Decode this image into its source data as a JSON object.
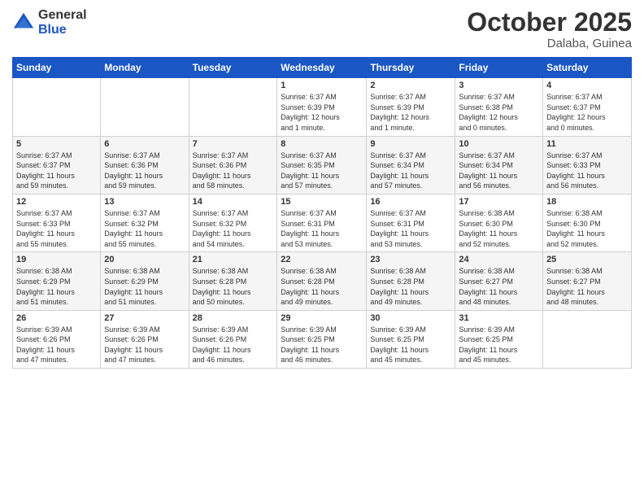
{
  "logo": {
    "general": "General",
    "blue": "Blue"
  },
  "title": "October 2025",
  "location": "Dalaba, Guinea",
  "days_header": [
    "Sunday",
    "Monday",
    "Tuesday",
    "Wednesday",
    "Thursday",
    "Friday",
    "Saturday"
  ],
  "weeks": [
    [
      {
        "num": "",
        "info": ""
      },
      {
        "num": "",
        "info": ""
      },
      {
        "num": "",
        "info": ""
      },
      {
        "num": "1",
        "info": "Sunrise: 6:37 AM\nSunset: 6:39 PM\nDaylight: 12 hours\nand 1 minute."
      },
      {
        "num": "2",
        "info": "Sunrise: 6:37 AM\nSunset: 6:39 PM\nDaylight: 12 hours\nand 1 minute."
      },
      {
        "num": "3",
        "info": "Sunrise: 6:37 AM\nSunset: 6:38 PM\nDaylight: 12 hours\nand 0 minutes."
      },
      {
        "num": "4",
        "info": "Sunrise: 6:37 AM\nSunset: 6:37 PM\nDaylight: 12 hours\nand 0 minutes."
      }
    ],
    [
      {
        "num": "5",
        "info": "Sunrise: 6:37 AM\nSunset: 6:37 PM\nDaylight: 11 hours\nand 59 minutes."
      },
      {
        "num": "6",
        "info": "Sunrise: 6:37 AM\nSunset: 6:36 PM\nDaylight: 11 hours\nand 59 minutes."
      },
      {
        "num": "7",
        "info": "Sunrise: 6:37 AM\nSunset: 6:36 PM\nDaylight: 11 hours\nand 58 minutes."
      },
      {
        "num": "8",
        "info": "Sunrise: 6:37 AM\nSunset: 6:35 PM\nDaylight: 11 hours\nand 57 minutes."
      },
      {
        "num": "9",
        "info": "Sunrise: 6:37 AM\nSunset: 6:34 PM\nDaylight: 11 hours\nand 57 minutes."
      },
      {
        "num": "10",
        "info": "Sunrise: 6:37 AM\nSunset: 6:34 PM\nDaylight: 11 hours\nand 56 minutes."
      },
      {
        "num": "11",
        "info": "Sunrise: 6:37 AM\nSunset: 6:33 PM\nDaylight: 11 hours\nand 56 minutes."
      }
    ],
    [
      {
        "num": "12",
        "info": "Sunrise: 6:37 AM\nSunset: 6:33 PM\nDaylight: 11 hours\nand 55 minutes."
      },
      {
        "num": "13",
        "info": "Sunrise: 6:37 AM\nSunset: 6:32 PM\nDaylight: 11 hours\nand 55 minutes."
      },
      {
        "num": "14",
        "info": "Sunrise: 6:37 AM\nSunset: 6:32 PM\nDaylight: 11 hours\nand 54 minutes."
      },
      {
        "num": "15",
        "info": "Sunrise: 6:37 AM\nSunset: 6:31 PM\nDaylight: 11 hours\nand 53 minutes."
      },
      {
        "num": "16",
        "info": "Sunrise: 6:37 AM\nSunset: 6:31 PM\nDaylight: 11 hours\nand 53 minutes."
      },
      {
        "num": "17",
        "info": "Sunrise: 6:38 AM\nSunset: 6:30 PM\nDaylight: 11 hours\nand 52 minutes."
      },
      {
        "num": "18",
        "info": "Sunrise: 6:38 AM\nSunset: 6:30 PM\nDaylight: 11 hours\nand 52 minutes."
      }
    ],
    [
      {
        "num": "19",
        "info": "Sunrise: 6:38 AM\nSunset: 6:29 PM\nDaylight: 11 hours\nand 51 minutes."
      },
      {
        "num": "20",
        "info": "Sunrise: 6:38 AM\nSunset: 6:29 PM\nDaylight: 11 hours\nand 51 minutes."
      },
      {
        "num": "21",
        "info": "Sunrise: 6:38 AM\nSunset: 6:28 PM\nDaylight: 11 hours\nand 50 minutes."
      },
      {
        "num": "22",
        "info": "Sunrise: 6:38 AM\nSunset: 6:28 PM\nDaylight: 11 hours\nand 49 minutes."
      },
      {
        "num": "23",
        "info": "Sunrise: 6:38 AM\nSunset: 6:28 PM\nDaylight: 11 hours\nand 49 minutes."
      },
      {
        "num": "24",
        "info": "Sunrise: 6:38 AM\nSunset: 6:27 PM\nDaylight: 11 hours\nand 48 minutes."
      },
      {
        "num": "25",
        "info": "Sunrise: 6:38 AM\nSunset: 6:27 PM\nDaylight: 11 hours\nand 48 minutes."
      }
    ],
    [
      {
        "num": "26",
        "info": "Sunrise: 6:39 AM\nSunset: 6:26 PM\nDaylight: 11 hours\nand 47 minutes."
      },
      {
        "num": "27",
        "info": "Sunrise: 6:39 AM\nSunset: 6:26 PM\nDaylight: 11 hours\nand 47 minutes."
      },
      {
        "num": "28",
        "info": "Sunrise: 6:39 AM\nSunset: 6:26 PM\nDaylight: 11 hours\nand 46 minutes."
      },
      {
        "num": "29",
        "info": "Sunrise: 6:39 AM\nSunset: 6:25 PM\nDaylight: 11 hours\nand 46 minutes."
      },
      {
        "num": "30",
        "info": "Sunrise: 6:39 AM\nSunset: 6:25 PM\nDaylight: 11 hours\nand 45 minutes."
      },
      {
        "num": "31",
        "info": "Sunrise: 6:39 AM\nSunset: 6:25 PM\nDaylight: 11 hours\nand 45 minutes."
      },
      {
        "num": "",
        "info": ""
      }
    ]
  ]
}
